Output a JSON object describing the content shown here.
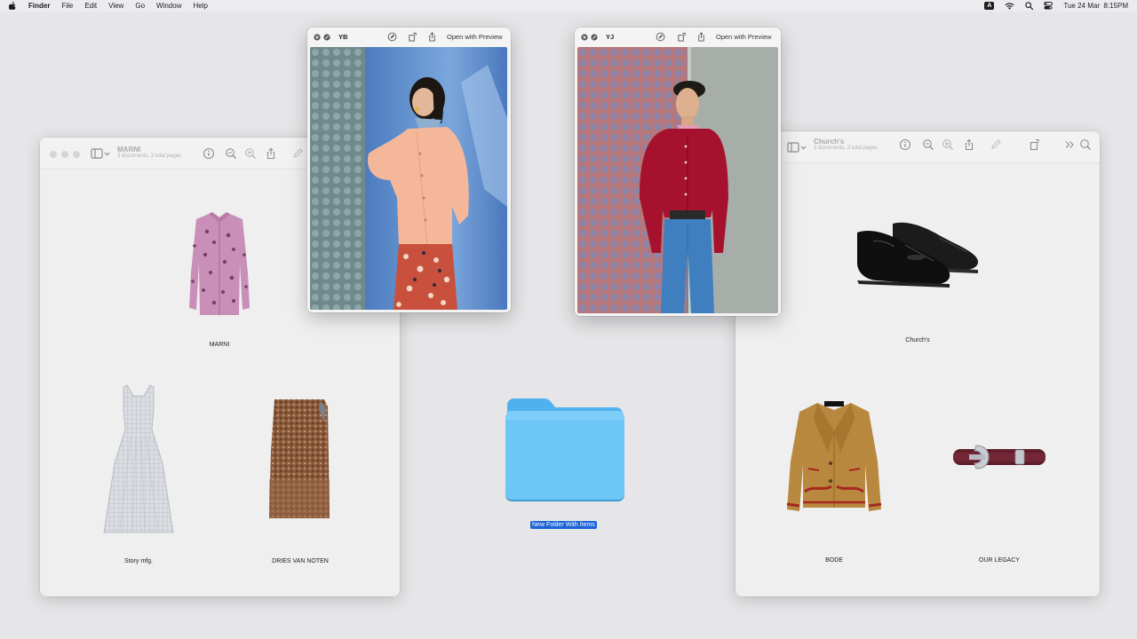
{
  "menubar": {
    "app_name": "Finder",
    "menus": [
      "File",
      "Edit",
      "View",
      "Go",
      "Window",
      "Help"
    ],
    "input_source": "A",
    "datetime": "Tue 24 Mar  8:15PM"
  },
  "marni_window": {
    "title": "MARNI",
    "subtitle": "3 documents, 3 total pages",
    "items": [
      {
        "label": "MARNI",
        "icon": "pink-embellished-shirt"
      },
      {
        "label": "Story mfg.",
        "icon": "grey-sleeveless-dress"
      },
      {
        "label": "DRIES VAN NOTEN",
        "icon": "brown-print-skirt"
      }
    ]
  },
  "churchs_window": {
    "title": "Church's",
    "subtitle": "3 documents, 3 total pages",
    "items": [
      {
        "label": "Church's",
        "icon": "black-penny-loafers"
      },
      {
        "label": "BODE",
        "icon": "tan-suede-jacket"
      },
      {
        "label": "OUR LEGACY",
        "icon": "burgundy-leather-belt"
      }
    ]
  },
  "quicklook_yb": {
    "title": "YB",
    "open_label": "Open with Preview"
  },
  "quicklook_yj": {
    "title": "YJ",
    "open_label": "Open with Preview"
  },
  "desktop": {
    "folder_label": "New Folder With Items"
  },
  "colors": {
    "folder_blue": "#6ec6f7",
    "folder_tab": "#4fb2ef",
    "selection_blue": "#1b63d6",
    "desktop_bg": "#e6e6e8",
    "window_bg": "#efefef"
  }
}
